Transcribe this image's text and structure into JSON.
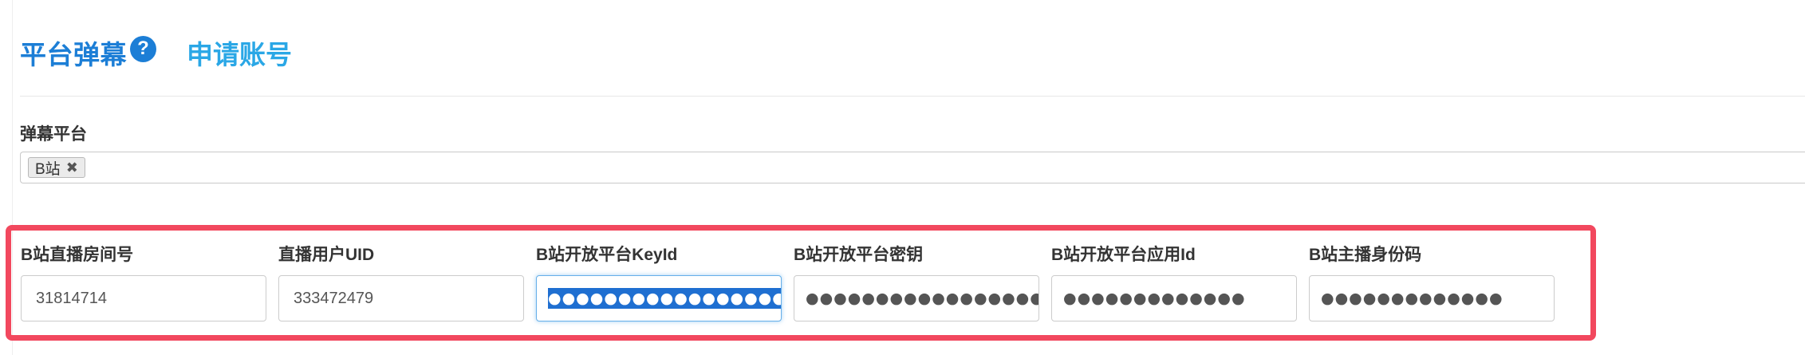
{
  "header": {
    "title": "平台弹幕",
    "help_icon": "question-circle-icon",
    "apply_link": "申请账号"
  },
  "platform": {
    "label": "弹幕平台",
    "selected_chip": "B站",
    "chip_remove": "✖"
  },
  "fields": [
    {
      "label": "B站直播房间号",
      "value": "31814714",
      "type": "text"
    },
    {
      "label": "直播用户UID",
      "value": "333472479",
      "type": "text"
    },
    {
      "label": "B站开放平台KeyId",
      "value": "●●●●●●●●●●●●●●●●●●●●●●●●",
      "type": "password",
      "focused": true
    },
    {
      "label": "B站开放平台密钥",
      "value": "●●●●●●●●●●●●●●●●●●●●●●●●",
      "type": "password"
    },
    {
      "label": "B站开放平台应用Id",
      "value": "●●●●●●●●●●●●●",
      "type": "password"
    },
    {
      "label": "B站主播身份码",
      "value": "●●●●●●●●●●●●●",
      "type": "password"
    }
  ],
  "colors": {
    "title_blue": "#1c7ed6",
    "link_blue": "#2aa7e6",
    "highlight_red": "#f2485e",
    "selection_blue": "#1f6fd1"
  }
}
